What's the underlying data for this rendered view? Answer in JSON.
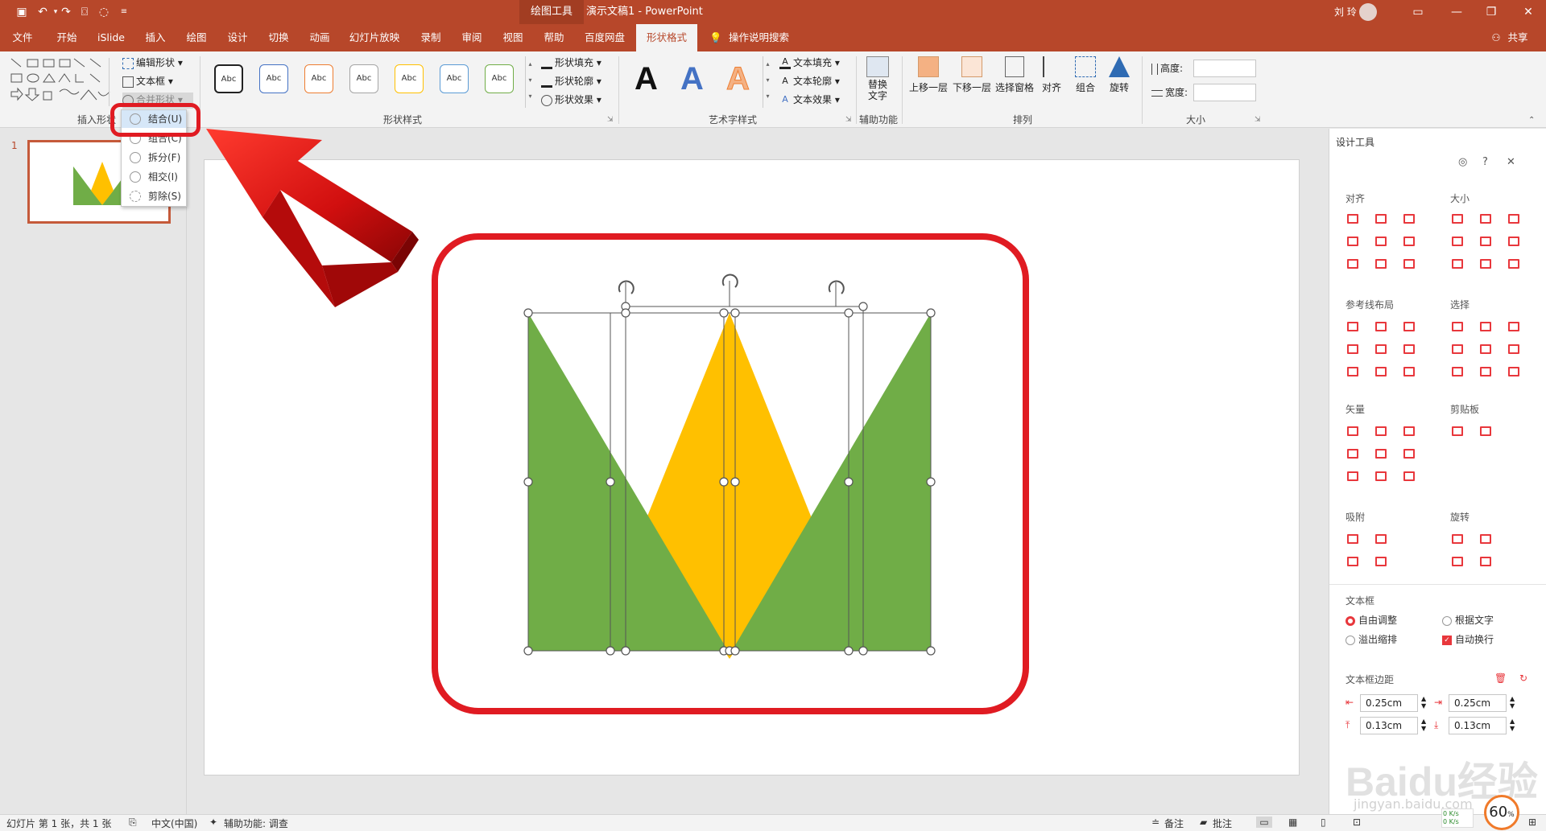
{
  "title_bar": {
    "context_tab": "绘图工具",
    "document": "演示文稿1",
    "separator": "-",
    "app": "PowerPoint",
    "user": "刘 玲",
    "share": "共享"
  },
  "tabs": [
    "文件",
    "开始",
    "iSlide",
    "插入",
    "绘图",
    "设计",
    "切换",
    "动画",
    "幻灯片放映",
    "录制",
    "审阅",
    "视图",
    "帮助",
    "百度网盘",
    "形状格式"
  ],
  "tell_me": "操作说明搜索",
  "ribbon": {
    "insert_shapes": {
      "label": "插入形状",
      "edit_shape": "编辑形状",
      "text_box": "文本框",
      "merge": "合并形状"
    },
    "shape_styles": {
      "label": "形状样式",
      "swatch_text": "Abc",
      "fill": "形状填充",
      "outline": "形状轮廓",
      "effects": "形状效果"
    },
    "wordart": {
      "label": "艺术字样式",
      "letter": "A",
      "text_fill": "文本填充",
      "text_outline": "文本轮廓",
      "text_effects": "文本效果"
    },
    "accessibility": {
      "label": "辅助功能",
      "alt_text": "替换文字"
    },
    "arrange": {
      "label": "排列",
      "forward": "上移一层",
      "backward": "下移一层",
      "selection_pane": "选择窗格",
      "align": "对齐",
      "group": "组合",
      "rotate": "旋转"
    },
    "size": {
      "label": "大小",
      "height_label": "高度:",
      "width_label": "宽度:"
    }
  },
  "merge_menu": {
    "items": [
      {
        "label": "结合(U)"
      },
      {
        "label": "组合(C)"
      },
      {
        "label": "拆分(F)"
      },
      {
        "label": "相交(I)"
      },
      {
        "label": "剪除(S)"
      }
    ]
  },
  "slide_panel": {
    "number": "1"
  },
  "design_pane": {
    "title": "设计工具",
    "sections": {
      "align": "对齐",
      "size": "大小",
      "guides": "参考线布局",
      "select": "选择",
      "vector": "矢量",
      "clipboard": "剪贴板",
      "snap": "吸附",
      "rotate": "旋转"
    },
    "textbox": {
      "label": "文本框",
      "free": "自由调整",
      "fit_text": "根据文字",
      "overflow": "溢出缩排",
      "wrap": "自动换行"
    },
    "margins": {
      "label": "文本框边距",
      "left": "0.25cm",
      "right": "0.25cm",
      "top": "0.13cm",
      "bottom": "0.13cm"
    }
  },
  "status_bar": {
    "slide_info": "幻灯片 第 1 张，共 1 张",
    "language": "中文(中国)",
    "accessibility": "辅助功能: 调查",
    "notes": "备注",
    "comments": "批注",
    "net_up": "0 K/s",
    "net_down": "0 K/s",
    "zoom": "60"
  },
  "watermark": {
    "brand": "Baidu经验",
    "url": "jingyan.baidu.com"
  },
  "colors": {
    "accent": "#b7472a",
    "green": "#70ad47",
    "yellow": "#ffc000",
    "red": "#e8373c",
    "highlight": "#e01b22"
  }
}
